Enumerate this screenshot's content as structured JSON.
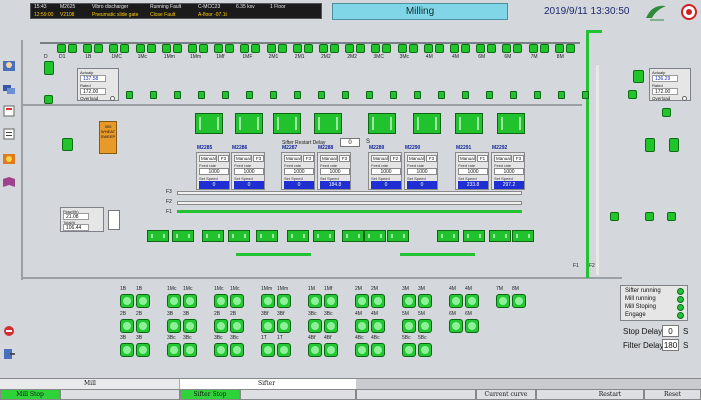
{
  "alarm": {
    "row1": [
      "15:43",
      "M2625",
      "Vibro discharger",
      "Running Fault",
      "C-MCC23",
      "6.35 ksv",
      "1 Floor"
    ],
    "row2": [
      "12:59:00",
      "V2108",
      "Pneumatic slide gate",
      "Close Fault",
      "A-floor -07.1t"
    ]
  },
  "title": "Milling",
  "datetime": "2019/9/11 13:30:50",
  "left_panel": {
    "label1": "Actualp",
    "value1": "137.58",
    "label2": "Rated",
    "value2": "172.00",
    "overload": "Overload"
  },
  "right_panel": {
    "label1": "Actualp",
    "value1": "136.29",
    "label2": "Rated",
    "value2": "172.00",
    "overload": "Overload"
  },
  "flow_panel": {
    "label1": "Flow(t/h)",
    "value1": "21.08",
    "label2": "Total(t)",
    "value2": "106.44"
  },
  "wheat_bin": {
    "line1": "305",
    "line2": "WHEAT",
    "line3": "SWEEP"
  },
  "top_fans": [
    "D1",
    "1B",
    "1MC",
    "1Mc",
    "1Mm",
    "1Mm",
    "1Mf",
    "1MF",
    "2M1",
    "2M1",
    "2M2",
    "2M2",
    "3MC",
    "3Mc",
    "4M",
    "4M",
    "6M",
    "6M",
    "7M",
    "8M"
  ],
  "top_fan_d": "D",
  "sifter_delay": {
    "label": "Sifter Restart Delay",
    "value": "0",
    "unit": "S"
  },
  "mills": [
    {
      "id": "M2285",
      "mode": "Manual",
      "fv": "F3",
      "cap1": "Feed rate",
      "sp": "1000",
      "cap2": "Set Speed",
      "bar": "0"
    },
    {
      "id": "M2286",
      "mode": "Manual",
      "fv": "F3",
      "cap1": "Feed rate",
      "sp": "1000",
      "cap2": "Set Speed",
      "bar": "0"
    },
    {
      "id": "M2287",
      "mode": "Manual",
      "fv": "F3",
      "cap1": "Feed rate",
      "sp": "1000",
      "cap2": "Set Speed",
      "bar": "0"
    },
    {
      "id": "M2288",
      "mode": "Manual",
      "fv": "F3",
      "cap1": "Feed rate",
      "sp": "1000",
      "cap2": "Set Speed",
      "bar": "184.8"
    },
    {
      "id": "M2289",
      "mode": "Manual",
      "fv": "F2",
      "cap1": "Feed rate",
      "sp": "1000",
      "cap2": "Set Speed",
      "bar": "0"
    },
    {
      "id": "M2290",
      "mode": "Manual",
      "fv": "F3",
      "cap1": "Feed rate",
      "sp": "1000",
      "cap2": "Set Speed",
      "bar": "0"
    },
    {
      "id": "M2291",
      "mode": "Manual",
      "fv": "F1",
      "cap1": "Feed rate",
      "sp": "1000",
      "cap2": "Set Speed",
      "bar": "233.8"
    },
    {
      "id": "M2292",
      "mode": "Manual",
      "fv": "F3",
      "cap1": "Feed rate",
      "sp": "1000",
      "cap2": "Set Speed",
      "bar": "297.2"
    }
  ],
  "lines": {
    "f3": "F3",
    "f2": "F2",
    "f1": "F1",
    "f1b": "F1",
    "f2b": "F2"
  },
  "rolls": {
    "row1": [
      "1B",
      "1B",
      "1Mc",
      "1Mc",
      "1Mc",
      "1Mc",
      "1Mm",
      "1Mm",
      "1M",
      "1Mf",
      "2M",
      "2M",
      "3M",
      "3M",
      "4M",
      "4M",
      "7M",
      "8M"
    ],
    "row2": [
      "2B",
      "2B",
      "3B",
      "3B",
      "2B",
      "2B",
      "3Bf",
      "3Bf",
      "3Bc",
      "3Bc",
      "4M",
      "4M",
      "5M",
      "5M",
      "6M",
      "6M"
    ],
    "row3": [
      "3B",
      "3B",
      "3Bc",
      "3Bc",
      "3Bc",
      "3Bc",
      "1T",
      "1T",
      "4Bf",
      "4Bf",
      "4Bc",
      "4Bc",
      "5Bc",
      "5Bc"
    ]
  },
  "status": {
    "sifter": "Sifter running",
    "mill": "Mill running",
    "stoping": "Mill Stoping",
    "engage": "Engage"
  },
  "stop_delay": {
    "label": "Stop Delay",
    "value": "0",
    "unit": "S"
  },
  "filter_delay": {
    "label": "Filter Delay",
    "value": "180",
    "unit": "S"
  },
  "bottom": {
    "mill_tab": "Mill",
    "sifter_tab": "Sifter",
    "mill_stop": "Mill Stop",
    "sifter_stop": "Sifter Stop",
    "current_curve": "Current curve",
    "restart": "Restart",
    "reset": "Reset"
  },
  "colors": {
    "green": "#22c22f",
    "blue_bar": "#1f2fd4",
    "alarm_yellow": "#ffcc00",
    "title_bg": "#80d6e6"
  }
}
